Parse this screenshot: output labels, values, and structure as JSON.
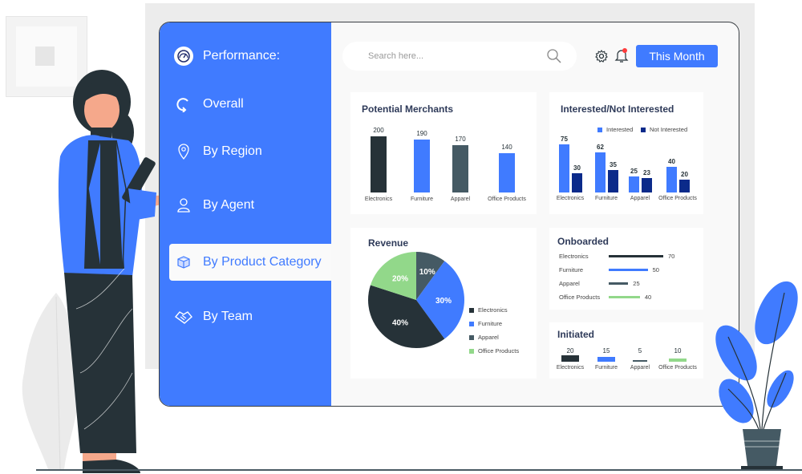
{
  "sidebar": {
    "header": {
      "label": "Performance:",
      "icon": "speedometer-icon"
    },
    "items": [
      {
        "label": "Overall",
        "icon": "refresh-icon",
        "active": false
      },
      {
        "label": "By Region",
        "icon": "map-pin-icon",
        "active": false
      },
      {
        "label": "By Agent",
        "icon": "user-icon",
        "active": false
      },
      {
        "label": "By Product Category",
        "icon": "box-icon",
        "active": true
      },
      {
        "label": "By Team",
        "icon": "handshake-icon",
        "active": false
      }
    ]
  },
  "topbar": {
    "search_placeholder": "Search here...",
    "settings_icon": "gear-icon",
    "notification_icon": "bell-icon",
    "period_button": "This Month"
  },
  "colors": {
    "accent": "#407bff",
    "dark": "#263238",
    "slate": "#455a64",
    "navy": "#0b2a8a",
    "green": "#92d88a",
    "notification_dot": "#ff3b3b"
  },
  "chart_data": [
    {
      "id": "potential_merchants",
      "type": "bar",
      "title": "Potential Merchants",
      "categories": [
        "Electronics",
        "Furniture",
        "Apparel",
        "Office Products"
      ],
      "values": [
        200,
        190,
        170,
        140
      ],
      "colors": [
        "#263238",
        "#407bff",
        "#455a64",
        "#407bff"
      ]
    },
    {
      "id": "interested",
      "type": "bar",
      "title": "Interested/Not Interested",
      "categories": [
        "Electronics",
        "Furniture",
        "Apparel",
        "Office Products"
      ],
      "series": [
        {
          "name": "Interested",
          "values": [
            75,
            62,
            25,
            40
          ],
          "color": "#407bff"
        },
        {
          "name": "Not Interested",
          "values": [
            30,
            35,
            23,
            20
          ],
          "color": "#0b2a8a"
        }
      ],
      "legend": "top"
    },
    {
      "id": "revenue",
      "type": "pie",
      "title": "Revenue",
      "slices": [
        {
          "label": "Apparel",
          "value": 10,
          "color": "#455a64"
        },
        {
          "label": "Furniture",
          "value": 30,
          "color": "#407bff"
        },
        {
          "label": "Electronics",
          "value": 40,
          "color": "#263238"
        },
        {
          "label": "Office Products",
          "value": 20,
          "color": "#92d88a"
        }
      ],
      "legend_order": [
        "Electronics",
        "Furniture",
        "Apparel",
        "Office Products"
      ],
      "legend": "right"
    },
    {
      "id": "onboarded",
      "type": "bar",
      "orientation": "horizontal",
      "title": "Onboarded",
      "categories": [
        "Electronics",
        "Furniture",
        "Apparel",
        "Office Products"
      ],
      "values": [
        70,
        50,
        25,
        40
      ],
      "colors": [
        "#263238",
        "#407bff",
        "#455a64",
        "#92d88a"
      ]
    },
    {
      "id": "initiated",
      "type": "bar",
      "title": "Initiated",
      "categories": [
        "Electronics",
        "Furniture",
        "Apparel",
        "Office Products"
      ],
      "values": [
        20,
        15,
        5,
        10
      ],
      "colors": [
        "#263238",
        "#407bff",
        "#455a64",
        "#92d88a"
      ]
    }
  ]
}
